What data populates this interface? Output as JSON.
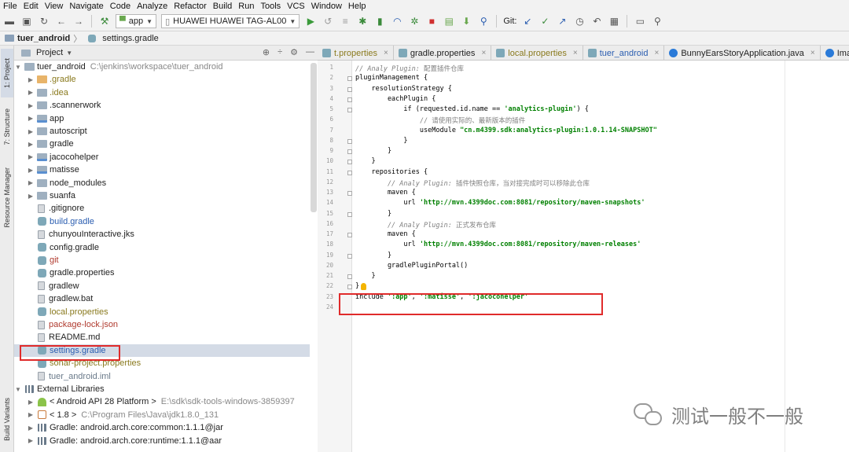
{
  "menu": [
    "File",
    "Edit",
    "View",
    "Navigate",
    "Code",
    "Analyze",
    "Refactor",
    "Build",
    "Run",
    "Tools",
    "VCS",
    "Window",
    "Help"
  ],
  "toolbar": {
    "run_config": "app",
    "device": "HUAWEI HUAWEI TAG-AL00",
    "git_label": "Git:"
  },
  "breadcrumb": {
    "project": "tuer_android",
    "file": "settings.gradle"
  },
  "left_strip": {
    "project_tab": "1: Project",
    "structure_tab": "7: Structure",
    "resource_tab": "Resource Manager",
    "build_variants_tab": "Build Variants"
  },
  "project_panel": {
    "title": "Project",
    "root_name": "tuer_android",
    "root_path": "C:\\jenkins\\workspace\\tuer_android",
    "items": [
      {
        "label": ".gradle",
        "kind": "folder-orange",
        "color": "c-olive",
        "arrow": true
      },
      {
        "label": ".idea",
        "kind": "folder",
        "color": "c-olive",
        "arrow": true
      },
      {
        "label": ".scannerwork",
        "kind": "folder",
        "color": "c-dark",
        "arrow": true
      },
      {
        "label": "app",
        "kind": "module",
        "color": "c-dark",
        "arrow": true
      },
      {
        "label": "autoscript",
        "kind": "folder",
        "color": "c-dark",
        "arrow": true
      },
      {
        "label": "gradle",
        "kind": "folder",
        "color": "c-dark",
        "arrow": true
      },
      {
        "label": "jacocohelper",
        "kind": "module",
        "color": "c-dark",
        "arrow": true
      },
      {
        "label": "matisse",
        "kind": "module",
        "color": "c-dark",
        "arrow": true
      },
      {
        "label": "node_modules",
        "kind": "folder",
        "color": "c-dark",
        "arrow": true
      },
      {
        "label": "suanfa",
        "kind": "folder",
        "color": "c-dark",
        "arrow": true
      },
      {
        "label": ".gitignore",
        "kind": "file",
        "color": "c-dark",
        "arrow": false
      },
      {
        "label": "build.gradle",
        "kind": "gradle",
        "color": "c-blue",
        "arrow": false
      },
      {
        "label": "chunyouInteractive.jks",
        "kind": "file",
        "color": "c-dark",
        "arrow": false
      },
      {
        "label": "config.gradle",
        "kind": "gradle",
        "color": "c-dark",
        "arrow": false
      },
      {
        "label": "git",
        "kind": "gradle",
        "color": "c-red",
        "arrow": false
      },
      {
        "label": "gradle.properties",
        "kind": "gradle",
        "color": "c-dark",
        "arrow": false
      },
      {
        "label": "gradlew",
        "kind": "file",
        "color": "c-dark",
        "arrow": false
      },
      {
        "label": "gradlew.bat",
        "kind": "file",
        "color": "c-dark",
        "arrow": false
      },
      {
        "label": "local.properties",
        "kind": "gradle",
        "color": "c-olive",
        "arrow": false
      },
      {
        "label": "package-lock.json",
        "kind": "file",
        "color": "c-red",
        "arrow": false
      },
      {
        "label": "README.md",
        "kind": "file",
        "color": "c-dark",
        "arrow": false
      },
      {
        "label": "settings.gradle",
        "kind": "gradle",
        "color": "c-blue",
        "arrow": false,
        "selected": true
      },
      {
        "label": "sonar-project.properties",
        "kind": "gradle",
        "color": "c-olive",
        "arrow": false
      },
      {
        "label": "tuer_android.iml",
        "kind": "file",
        "color": "c-gray",
        "arrow": false
      }
    ],
    "external_libraries": "External Libraries",
    "libs": [
      {
        "label": "< Android API 28 Platform >",
        "path": "E:\\sdk\\sdk-tools-windows-3859397",
        "kind": "android"
      },
      {
        "label": "< 1.8 >",
        "path": "C:\\Program Files\\Java\\jdk1.8.0_131",
        "kind": "java"
      },
      {
        "label": "Gradle: android.arch.core:common:1.1.1@jar",
        "path": "",
        "kind": "lib"
      },
      {
        "label": "Gradle: android.arch.core:runtime:1.1.1@aar",
        "path": "",
        "kind": "lib"
      }
    ]
  },
  "tabs": [
    {
      "label": "t.properties",
      "icon": "g",
      "active": false,
      "color": "c-olive"
    },
    {
      "label": "gradle.properties",
      "icon": "g",
      "active": false,
      "color": "c-dark"
    },
    {
      "label": "local.properties",
      "icon": "g",
      "active": false,
      "color": "c-olive"
    },
    {
      "label": "tuer_android",
      "icon": "g",
      "active": false,
      "color": "c-blue"
    },
    {
      "label": "BunnyEarsStoryApplication.java",
      "icon": "c",
      "active": false,
      "color": "c-dark"
    },
    {
      "label": "ImageCompress",
      "icon": "c",
      "active": false,
      "color": "c-dark"
    }
  ],
  "line_numbers": [
    "1",
    "2",
    "3",
    "4",
    "5",
    "6",
    "7",
    "8",
    "9",
    "10",
    "11",
    "12",
    "13",
    "14",
    "15",
    "16",
    "17",
    "18",
    "19",
    "20",
    "21",
    "22",
    "23",
    "24"
  ],
  "code_lines": [
    [
      {
        "t": "// ",
        "c": "cm"
      },
      {
        "t": "Analy Plugin: ",
        "c": "cm"
      },
      {
        "t": "配置插件仓库",
        "c": "cm-cn"
      }
    ],
    [
      {
        "t": "pluginManagement {",
        "c": ""
      }
    ],
    [
      {
        "t": "    resolutionStrategy {",
        "c": ""
      }
    ],
    [
      {
        "t": "        eachPlugin {",
        "c": ""
      }
    ],
    [
      {
        "t": "            if ",
        "c": ""
      },
      {
        "t": "(requested.id.name == ",
        "c": ""
      },
      {
        "t": "'analytics-plugin'",
        "c": "str"
      },
      {
        "t": ") {",
        "c": ""
      }
    ],
    [
      {
        "t": "                ",
        "c": ""
      },
      {
        "t": "// 请使用实际的、最新版本的插件",
        "c": "cm-cn"
      }
    ],
    [
      {
        "t": "                useModule ",
        "c": ""
      },
      {
        "t": "\"cn.m4399.sdk:analytics-plugin:1.0.1.14-SNAPSHOT\"",
        "c": "str"
      }
    ],
    [
      {
        "t": "            }",
        "c": ""
      }
    ],
    [
      {
        "t": "        }",
        "c": ""
      }
    ],
    [
      {
        "t": "    }",
        "c": ""
      }
    ],
    [
      {
        "t": "    repositories {",
        "c": ""
      }
    ],
    [
      {
        "t": "        // ",
        "c": "cm"
      },
      {
        "t": "Analy Plugin: ",
        "c": "cm"
      },
      {
        "t": "插件快照仓库，当对接完成时可以移除此仓库",
        "c": "cm-cn"
      }
    ],
    [
      {
        "t": "        maven {",
        "c": ""
      }
    ],
    [
      {
        "t": "            url ",
        "c": ""
      },
      {
        "t": "'http://mvn.4399doc.com:8081/repository/maven-snapshots'",
        "c": "str"
      }
    ],
    [
      {
        "t": "        }",
        "c": ""
      }
    ],
    [
      {
        "t": "        // ",
        "c": "cm"
      },
      {
        "t": "Analy Plugin: ",
        "c": "cm"
      },
      {
        "t": "正式发布仓库",
        "c": "cm-cn"
      }
    ],
    [
      {
        "t": "        maven {",
        "c": ""
      }
    ],
    [
      {
        "t": "            url ",
        "c": ""
      },
      {
        "t": "'http://mvn.4399doc.com:8081/repository/maven-releases'",
        "c": "str"
      }
    ],
    [
      {
        "t": "        }",
        "c": ""
      }
    ],
    [
      {
        "t": "        gradlePluginPortal()",
        "c": ""
      }
    ],
    [
      {
        "t": "    }",
        "c": ""
      }
    ],
    [
      {
        "t": "}",
        "c": ""
      }
    ],
    [
      {
        "t": "include ",
        "c": ""
      },
      {
        "t": "':app'",
        "c": "str"
      },
      {
        "t": ", ",
        "c": ""
      },
      {
        "t": "':matisse'",
        "c": "str"
      },
      {
        "t": ", ",
        "c": ""
      },
      {
        "t": "':jacocohelper'",
        "c": "str"
      }
    ],
    [
      {
        "t": "",
        "c": ""
      }
    ]
  ],
  "watermark": "测试一般不一般",
  "colors": {
    "highlight_box": "#e02b2b",
    "selection": "#d4dbe6",
    "string": "#008000",
    "comment": "#808080"
  }
}
